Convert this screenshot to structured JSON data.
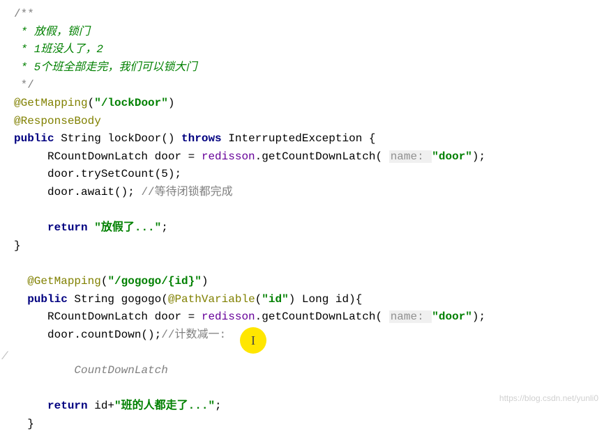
{
  "code": {
    "comment_start": "/**",
    "comment_l1": " * 放假，锁门",
    "comment_l2": " * 1班没人了，2",
    "comment_l3": " * 5个班全部走完，我们可以锁大门",
    "comment_end": " */",
    "anno_getmapping": "@GetMapping",
    "anno_lockdoor_path": "(\"/lockDoor\")",
    "anno_responsebody": "@ResponseBody",
    "kw_public": "public",
    "type_string": "String",
    "method_lockdoor": "lockDoor()",
    "kw_throws": "throws",
    "exc_interrupted": "InterruptedException {",
    "line_latch1_pre": "    RCountDownLatch door = ",
    "redisson": "redisson",
    "getcount": ".getCountDownLatch( ",
    "param_hint": "name: ",
    "door_str": "\"door\"",
    "close_paren": ");",
    "line_tryset": "    door.trySetCount(5);",
    "line_await": "    door.await(); ",
    "comment_await": "//等待闭锁都完成",
    "kw_return": "return",
    "return_str1": "\"放假了...\"",
    "semicolon": ";",
    "close_brace": "}",
    "anno_getmapping2": "@GetMapping",
    "gogogo_path": "(\"/gogogo/{id}\")",
    "method_gogogo_sig_pre": "String gogogo(",
    "anno_pathvar": "@PathVariable",
    "pathvar_arg": "(\"id\")",
    "long_id": " Long id){",
    "line_latch2_pre": "    RCountDownLatch door = ",
    "line_countdown": "    door.countDown();",
    "comment_countdown": "//计数减一:",
    "italic_hint": "CountDownLatch",
    "return2_pre": "id+",
    "return_str2": "\"班的人都走了...\"",
    "close_brace2": "}"
  },
  "cursor_char": "I",
  "left_mark": "/",
  "watermark": "https://blog.csdn.net/yunli0"
}
